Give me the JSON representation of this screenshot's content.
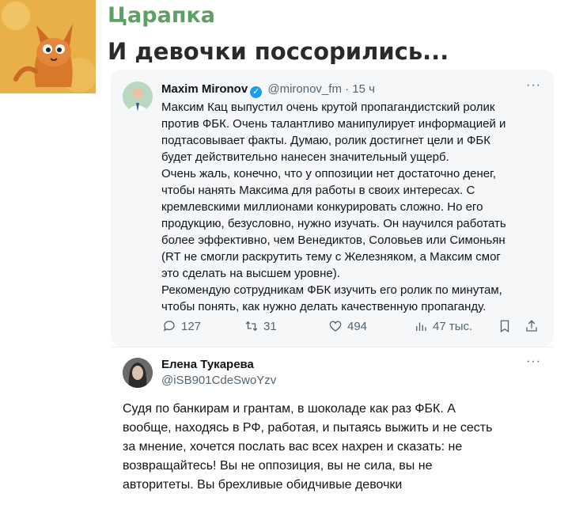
{
  "post": {
    "channel": "Царапка",
    "title": "И девочки поссорились..."
  },
  "tweet1": {
    "name": "Maxim Mironov",
    "handle": "@mironov_fm",
    "time": "· 15 ч",
    "text": "Максим Кац выпустил очень крутой пропагандистский ролик\nпротив ФБК. Очень талантливо манипулирует информацией и\nподтасовывает факты.  Думаю, ролик достигнет цели и ФБК\nбудет действительно нанесен значительный ущерб.\nОчень жаль, конечно, что у оппозиции нет достаточно денег,\nчтобы нанять Максима для работы в своих интересах. С\nкремлевскими миллионами конкурировать сложно. Но его\nпродукцию, безусловно, нужно изучать. Он научился работать\nболее эффективно, чем Венедиктов, Соловьев или Симоньян\n(RT не смогли раскрутить тему с Железняком, а Максим смог\nэто сделать на высшем уровне).\nРекомендую сотрудникам ФБК изучить его ролик по минутам,\nчтобы понять, как нужно делать качественную пропаганду.",
    "replies": "127",
    "retweets": "31",
    "likes": "494",
    "views": "47 тыс."
  },
  "tweet2": {
    "name": "Елена Тукарева",
    "handle": "@iSB901CdeSwoYzv",
    "text": "Судя по банкирам и грантам, в шоколаде как раз ФБК. А\nвообще, находясь в РФ, работая, и пытаясь выжить и не сесть\nза мнение, хочется послать вас всех нахрен и сказать: не\nвозвращайтесь! Вы не оппозиция, вы не сила, вы не\nавторитеты. Вы брехливые обидчивые девочки"
  },
  "icons": {
    "menu": "···",
    "verified": "✓"
  },
  "colors": {
    "channel": "#5e9f62",
    "verified": "#1d9bf0",
    "muted": "#536471"
  }
}
